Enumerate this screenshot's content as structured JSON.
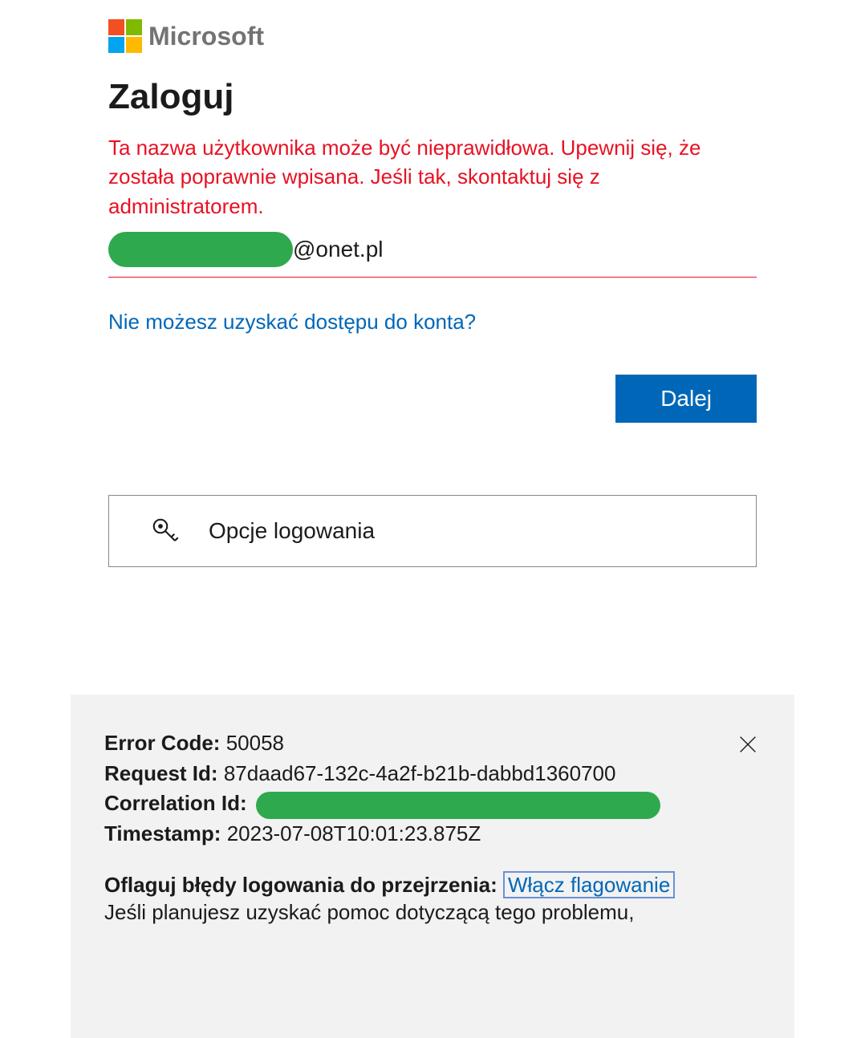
{
  "brand": {
    "name": "Microsoft"
  },
  "login": {
    "title": "Zaloguj",
    "error_message": "Ta nazwa użytkownika może być nieprawidłowa. Upewnij się, że została poprawnie wpisana. Jeśli tak, skontaktuj się z administratorem.",
    "email_domain": "@onet.pl",
    "access_link": "Nie możesz uzyskać dostępu do konta?",
    "next_button": "Dalej",
    "signin_options": "Opcje logowania"
  },
  "debug": {
    "error_code_label": "Error Code:",
    "error_code_value": "50058",
    "request_id_label": "Request Id:",
    "request_id_value": "87daad67-132c-4a2f-b21b-dabbd1360700",
    "correlation_id_label": "Correlation Id:",
    "timestamp_label": "Timestamp:",
    "timestamp_value": "2023-07-08T10:01:23.875Z",
    "flag_label": "Oflaguj błędy logowania do przejrzenia:",
    "flag_link": "Włącz flagowanie",
    "help_text": "Jeśli planujesz uzyskać pomoc dotyczącą tego problemu,"
  }
}
